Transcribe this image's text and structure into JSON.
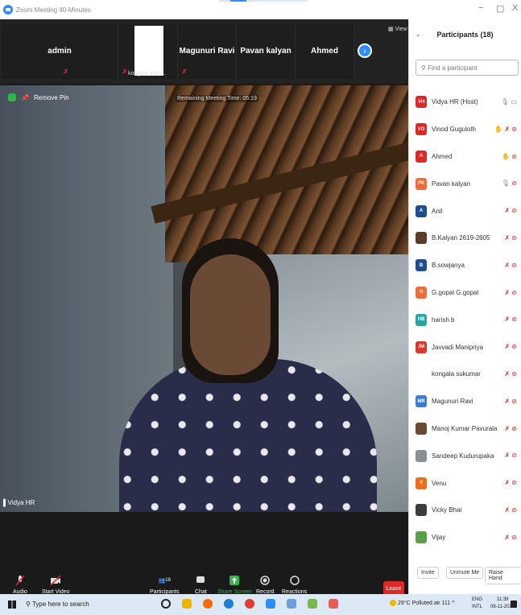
{
  "window": {
    "title": "Zoom Meeting 40-Minutes",
    "controls": [
      "−",
      "▢",
      "X"
    ]
  },
  "strip": {
    "thumbs": [
      {
        "name": "admin",
        "label": ""
      },
      {
        "name": "",
        "label": "kongala suku..."
      },
      {
        "name": "Magunuri Ravi",
        "label": ""
      },
      {
        "name": "Pavan kalyan",
        "label": ""
      },
      {
        "name": "Ahmed",
        "label": ""
      }
    ],
    "view_label": "View"
  },
  "main_video": {
    "remove_pin": "Remove Pin",
    "remaining": "Remaining Meeting Time: 05:19",
    "speaker_name": "Vidya HR"
  },
  "toolbar": {
    "audio": "Audio",
    "start_video": "Start Video",
    "participants": "Participants",
    "participants_count": "18",
    "chat": "Chat",
    "share_screen": "Share Screen",
    "record": "Record",
    "reactions": "Reactions",
    "leave": "Leave"
  },
  "panel": {
    "title": "Participants (18)",
    "search_placeholder": "Find a participant",
    "participants": [
      {
        "initials": "VH",
        "name": "Vidya HR (Host)",
        "color": "#e02828"
      },
      {
        "initials": "VG",
        "name": "Vinod Guguloth",
        "color": "#e02828"
      },
      {
        "initials": "A",
        "name": "Ahmed",
        "color": "#e02828"
      },
      {
        "initials": "PK",
        "name": "Pavan kalyan",
        "color": "#f26b3a"
      },
      {
        "initials": "A",
        "name": "Anil",
        "color": "#1f4e8c"
      },
      {
        "initials": "",
        "name": "B.Kalyan 2619-2605",
        "color": "#5a3c2a"
      },
      {
        "initials": "B",
        "name": "B.sowjanya",
        "color": "#1f4e8c"
      },
      {
        "initials": "G",
        "name": "G.gopal G.gopal",
        "color": "#f26b3a"
      },
      {
        "initials": "HB",
        "name": "harish b",
        "color": "#2aa5a0"
      },
      {
        "initials": "JM",
        "name": "Javvadi Manipriya",
        "color": "#d8382b"
      },
      {
        "initials": "",
        "name": "kongala sukumar",
        "color": "#ffffff"
      },
      {
        "initials": "MR",
        "name": "Magunuri Ravi",
        "color": "#3a7bd5"
      },
      {
        "initials": "",
        "name": "Manoj Kumar Pavurala",
        "color": "#6b4a35"
      },
      {
        "initials": "",
        "name": "Sandeep Kudurupaka",
        "color": "#8a8f95"
      },
      {
        "initials": "V",
        "name": "Venu",
        "color": "#f26b1a"
      },
      {
        "initials": "",
        "name": "Vicky Bhai",
        "color": "#3c3c3c"
      },
      {
        "initials": "",
        "name": "Vijay",
        "color": "#5c9e4a"
      }
    ],
    "buttons": {
      "invite": "Invite",
      "unmute_me": "Unmute Me",
      "raise_hand": "Raise Hand"
    }
  },
  "taskbar": {
    "search": "Type here to search",
    "weather": "29°C Polluted air 111",
    "lang_top": "ENG",
    "lang_bottom": "INTL",
    "time": "11:39",
    "date": "08-11-2021"
  }
}
